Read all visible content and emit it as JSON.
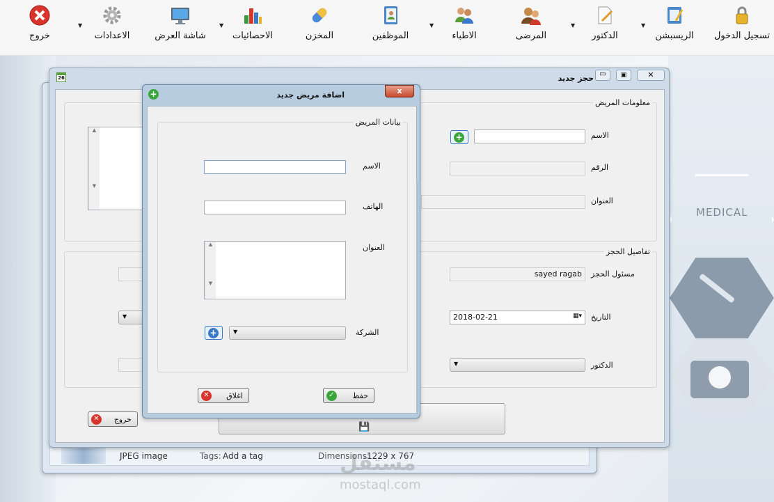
{
  "toolbar": {
    "items": [
      {
        "label": "تسجيل الدخول",
        "icon": "lock-icon"
      },
      {
        "label": "الريسبشن",
        "icon": "notepad-icon"
      },
      {
        "label": "الدكتور",
        "icon": "document-pencil-icon"
      },
      {
        "label": "المرضى",
        "icon": "patients-icon"
      },
      {
        "label": "الاطباء",
        "icon": "doctors-icon"
      },
      {
        "label": "الموظفين",
        "icon": "address-book-icon"
      },
      {
        "label": "المخزن",
        "icon": "pill-icon"
      },
      {
        "label": "الاحصائيات",
        "icon": "bar-chart-icon"
      },
      {
        "label": "شاشة العرض",
        "icon": "monitor-icon"
      },
      {
        "label": "الاعدادات",
        "icon": "gear-icon"
      },
      {
        "label": "خروج",
        "icon": "exit-icon"
      }
    ]
  },
  "background": {
    "hex_text": "MEDICAL"
  },
  "photo_viewer": {
    "type_label": "JPEG image",
    "tags_label": "Tags:",
    "tags_value": "Add a tag",
    "dimensions_label": "Dimensions:",
    "dimensions_value": "1229 x 767"
  },
  "watermark": {
    "arabic": "مستقل",
    "latin": "mostaql.com"
  },
  "booking_window": {
    "title": "حجز جديد",
    "calendar_number": "26",
    "patient_info": {
      "title": "معلومات المريض",
      "name_label": "الاسم",
      "number_label": "الرقم",
      "address_label": "العنوان"
    },
    "booking_details": {
      "title": "تفاصيل الحجز",
      "responsible_label": "مسئول الحجز",
      "responsible_value": "sayed ragab",
      "date_label": "التاريخ",
      "date_value": "2018-02-21",
      "doctor_label": "الدكتور"
    },
    "exit_button": "خروج"
  },
  "dialog": {
    "title": "اضافة مريض جديد",
    "group_title": "بيانات المريض",
    "name_label": "الاسم",
    "phone_label": "الهاتف",
    "address_label": "العنوان",
    "company_label": "الشركة",
    "save_button": "حفظ",
    "close_button": "اغلاق"
  },
  "colors": {
    "accent_green": "#3aa53a",
    "accent_red": "#d9342b",
    "accent_blue": "#3a78c8",
    "window_frame": "#cfdbe8"
  }
}
